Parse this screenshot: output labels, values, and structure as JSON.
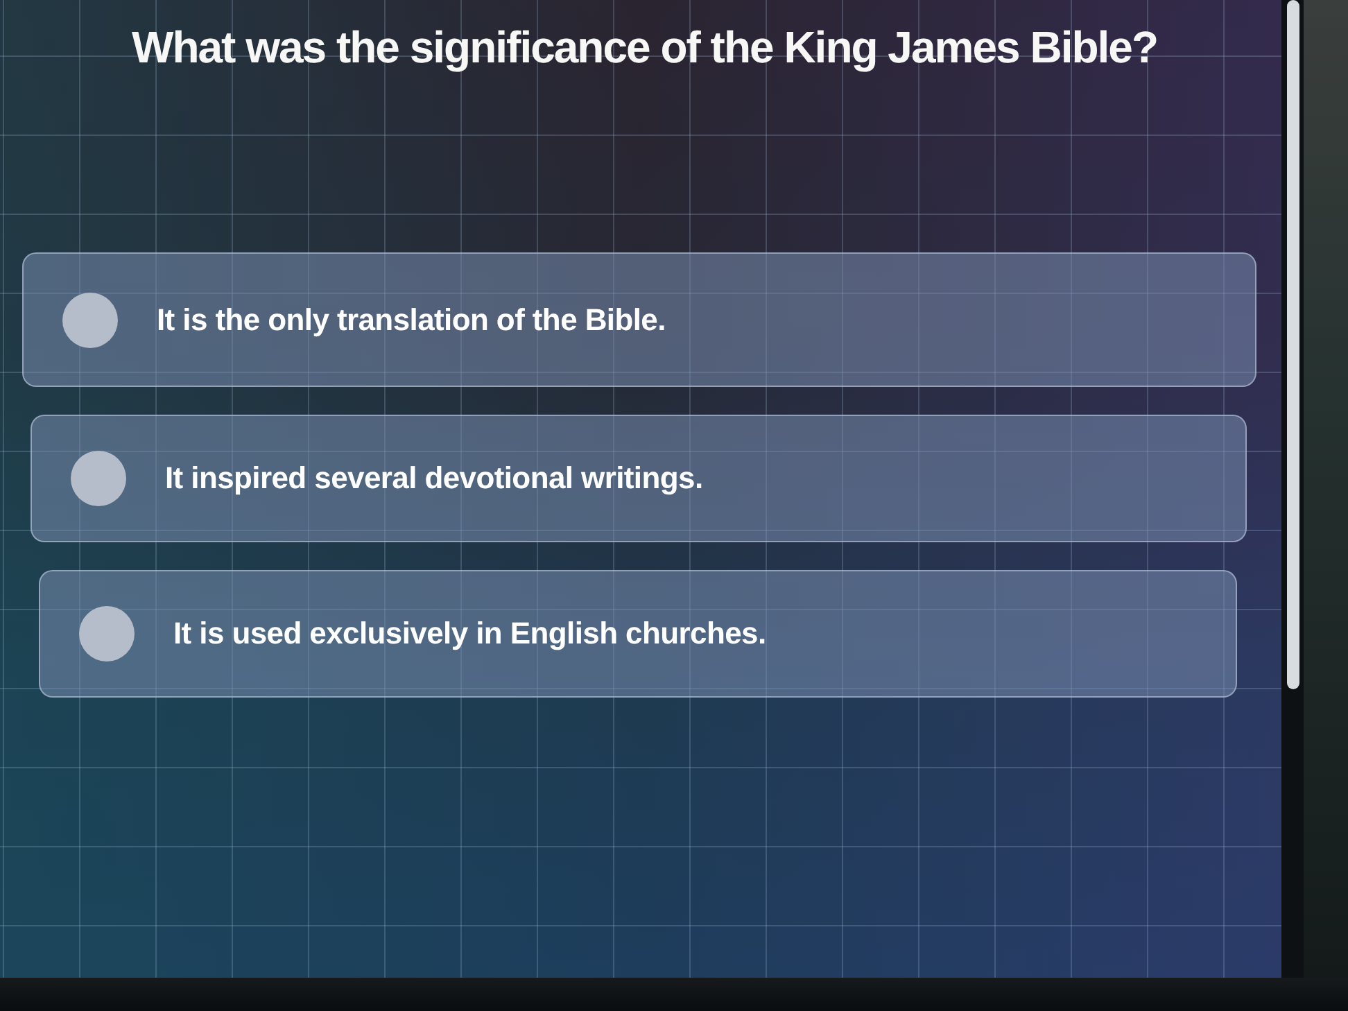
{
  "question": "What was the significance of the King James Bible?",
  "options": [
    {
      "text": "It is the only translation of the Bible.",
      "selected": false
    },
    {
      "text": "It inspired several devotional writings.",
      "selected": false
    },
    {
      "text": "It is used exclusively in English churches.",
      "selected": false
    }
  ]
}
